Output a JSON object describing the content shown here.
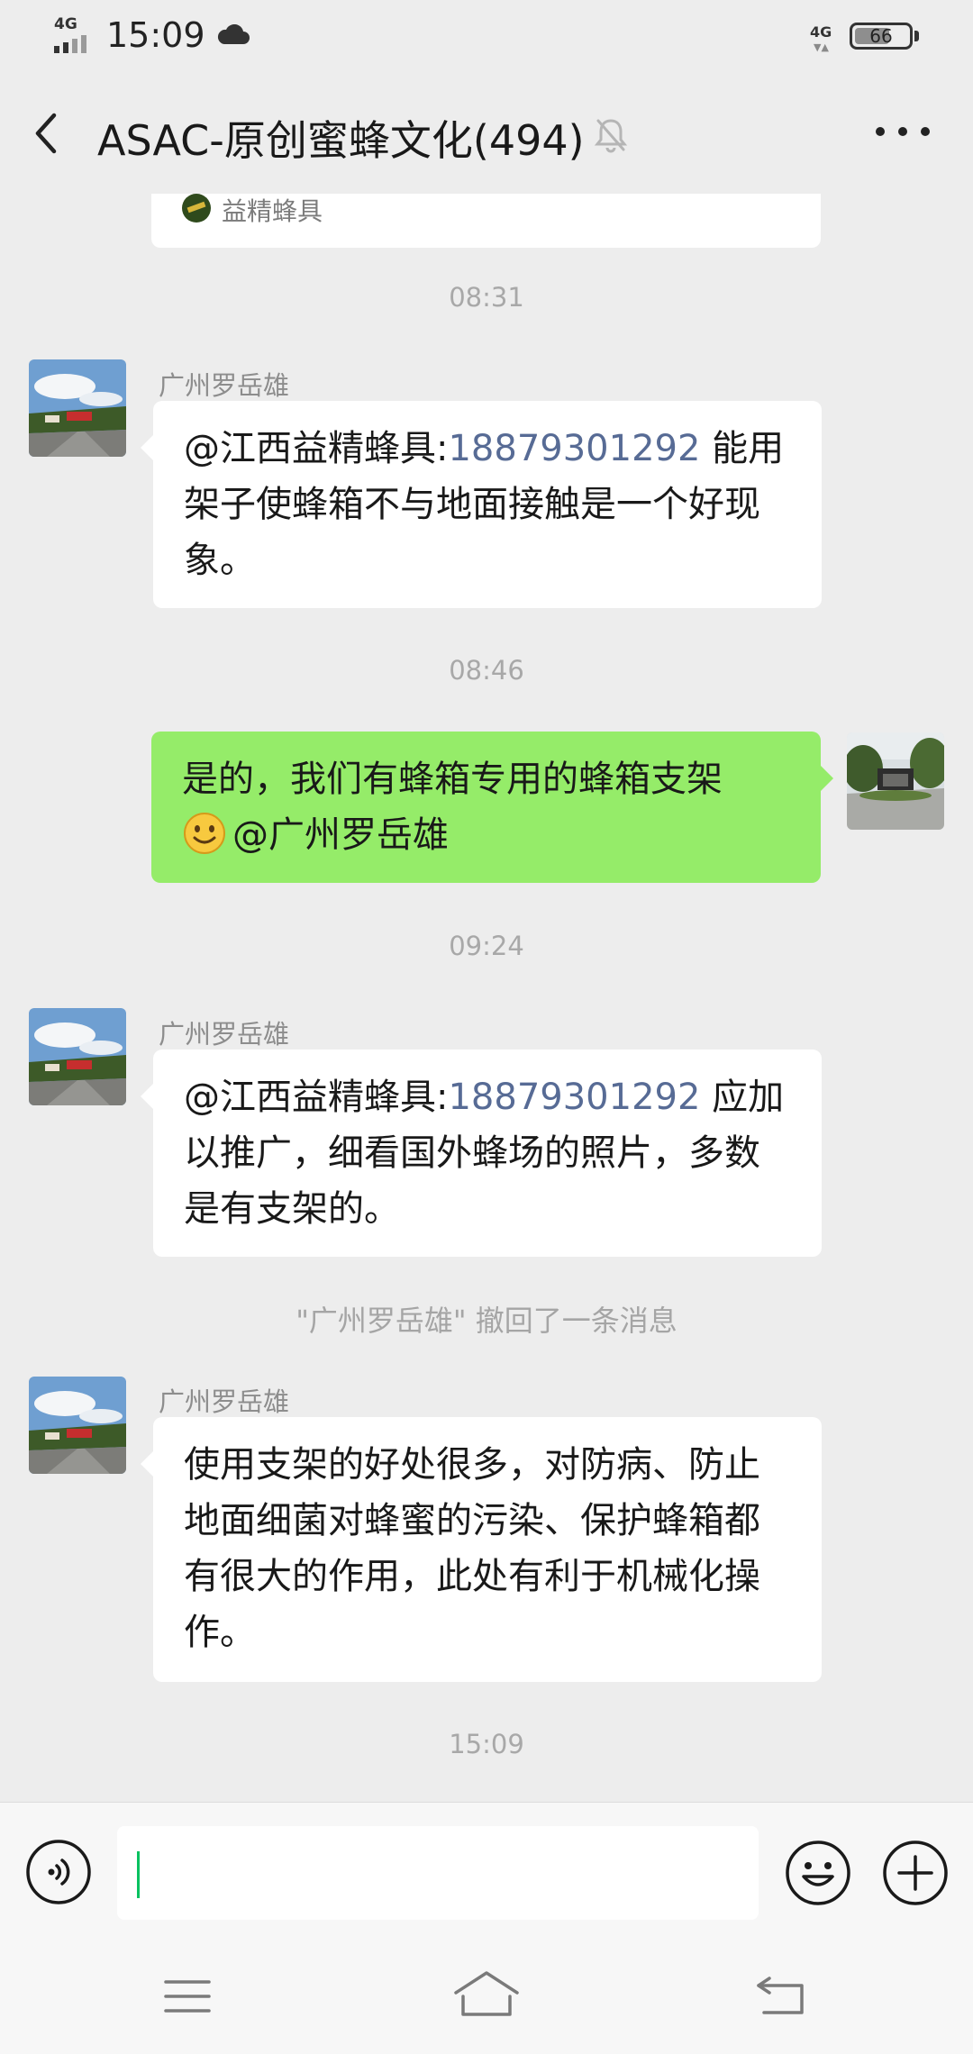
{
  "status_bar": {
    "signal_label": "4G",
    "time": "15:09",
    "network_label": "4G",
    "battery": "66",
    "battery_level": 0.66
  },
  "header": {
    "title": "ASAC-原创蜜蜂文化(494)"
  },
  "card": {
    "source": "益精蜂具"
  },
  "messages": [
    {
      "type": "time",
      "text": "08:31"
    },
    {
      "type": "incoming",
      "sender": "广州罗岳雄",
      "mention": "@江西益精蜂具:",
      "link": "18879301292",
      "text": " 能用架子使蜂箱不与地面接触是一个好现象。"
    },
    {
      "type": "time",
      "text": "08:46"
    },
    {
      "type": "outgoing",
      "text": "是的，我们有蜂箱专用的蜂箱支架",
      "emoji": "smiley-emoji",
      "mention": "@广州罗岳雄"
    },
    {
      "type": "time",
      "text": "09:24"
    },
    {
      "type": "incoming",
      "sender": "广州罗岳雄",
      "mention": "@江西益精蜂具:",
      "link": "18879301292",
      "text": " 应加以推广，细看国外蜂场的照片，多数是有支架的。"
    },
    {
      "type": "system",
      "text": "\"广州罗岳雄\" 撤回了一条消息"
    },
    {
      "type": "incoming",
      "sender": "广州罗岳雄",
      "text": "使用支架的好处很多，对防病、防止地面细菌对蜂蜜的污染、保护蜂箱都有很大的作用，此处有利于机械化操作。"
    },
    {
      "type": "time",
      "text": "15:09"
    }
  ],
  "input": {
    "value": "",
    "placeholder": ""
  },
  "icons": {
    "back": "back-arrow-icon",
    "mute": "bell-off-icon",
    "more": "more-dots-icon",
    "voice": "voice-icon",
    "emoji": "emoji-icon",
    "plus": "plus-icon",
    "nav_menu": "menu-icon",
    "nav_home": "home-icon",
    "nav_back": "return-icon"
  },
  "colors": {
    "background": "#ededed",
    "incoming_bubble": "#ffffff",
    "outgoing_bubble": "#95ec69",
    "link": "#576b95",
    "cursor": "#07c160"
  }
}
